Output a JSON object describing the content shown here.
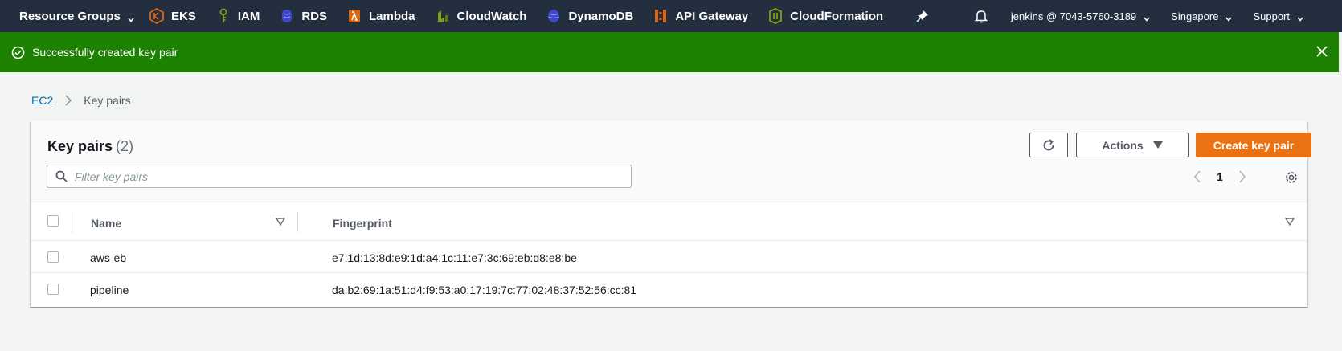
{
  "nav": {
    "resource_groups": "Resource Groups",
    "services": [
      {
        "label": "EKS",
        "icon": "eks-icon",
        "color": "#d86613"
      },
      {
        "label": "IAM",
        "icon": "iam-icon",
        "color": "#7aa116"
      },
      {
        "label": "RDS",
        "icon": "rds-icon",
        "color": "#3b48cc"
      },
      {
        "label": "Lambda",
        "icon": "lambda-icon",
        "color": "#d86613"
      },
      {
        "label": "CloudWatch",
        "icon": "cloudwatch-icon",
        "color": "#7aa116"
      },
      {
        "label": "DynamoDB",
        "icon": "dynamodb-icon",
        "color": "#3b48cc"
      },
      {
        "label": "API Gateway",
        "icon": "api-gateway-icon",
        "color": "#d86613"
      },
      {
        "label": "CloudFormation",
        "icon": "cloudformation-icon",
        "color": "#7aa116"
      }
    ],
    "account": "jenkins @ 7043-5760-3189",
    "region": "Singapore",
    "support": "Support",
    "bg_color": "#232f3e"
  },
  "flash": {
    "message": "Successfully created key pair",
    "color": "#1d8102"
  },
  "breadcrumb": {
    "root": "EC2",
    "current": "Key pairs"
  },
  "panel": {
    "title": "Key pairs",
    "count": "(2)",
    "actions_label": "Actions",
    "create_label": "Create key pair",
    "filter_placeholder": "Filter key pairs",
    "page": "1",
    "accent_color": "#ec7211"
  },
  "table": {
    "columns": [
      "Name",
      "Fingerprint"
    ],
    "rows": [
      {
        "name": "aws-eb",
        "fingerprint": "e7:1d:13:8d:e9:1d:a4:1c:11:e7:3c:69:eb:d8:e8:be"
      },
      {
        "name": "pipeline",
        "fingerprint": "da:b2:69:1a:51:d4:f9:53:a0:17:19:7c:77:02:48:37:52:56:cc:81"
      }
    ]
  }
}
